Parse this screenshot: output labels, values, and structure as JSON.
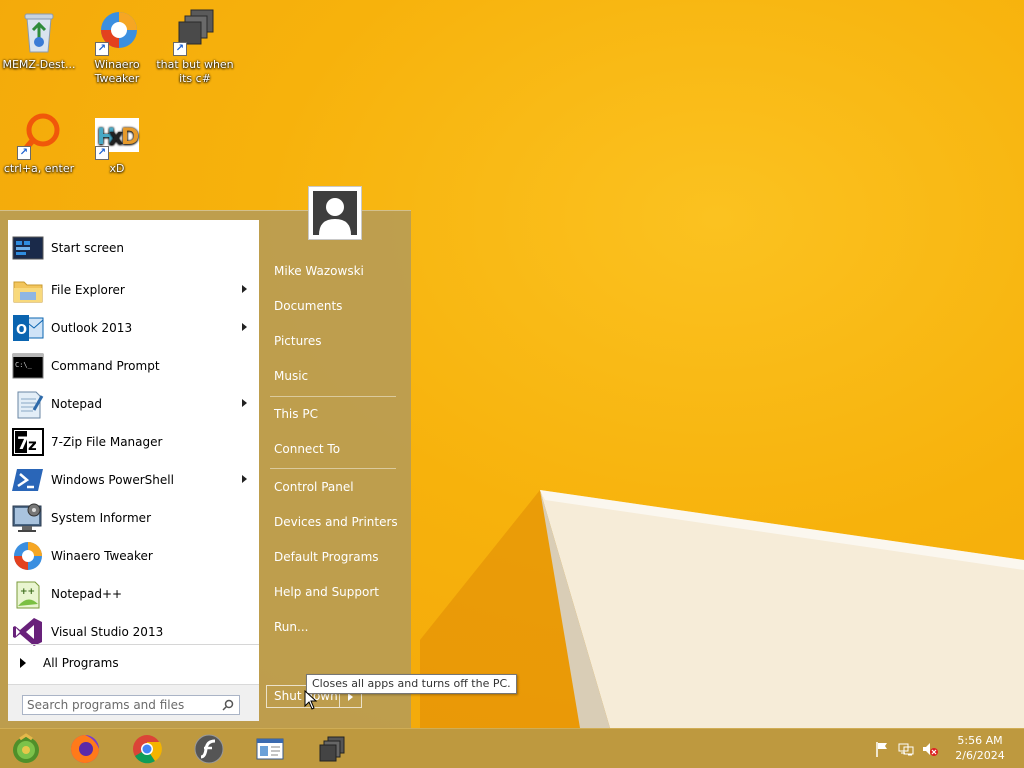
{
  "desktop": {
    "icons": [
      {
        "label": "MEMZ-Dest...",
        "icon": "recycle-bin-icon"
      },
      {
        "label": "Winaero Tweaker",
        "icon": "winaero-tweaker-icon"
      },
      {
        "label": "that but when its c#",
        "icon": "stacked-windows-icon"
      },
      {
        "label": "ctrl+a, enter",
        "icon": "magnifier-app-icon"
      },
      {
        "label": "xD",
        "icon": "hxd-icon"
      }
    ]
  },
  "start_menu": {
    "programs": [
      {
        "label": "Start screen",
        "icon": "start-screen-icon",
        "submenu": false
      },
      {
        "label": "File Explorer",
        "icon": "folder-icon",
        "submenu": true
      },
      {
        "label": "Outlook 2013",
        "icon": "outlook-icon",
        "submenu": true
      },
      {
        "label": "Command Prompt",
        "icon": "cmd-icon",
        "submenu": false
      },
      {
        "label": "Notepad",
        "icon": "notepad-icon",
        "submenu": true
      },
      {
        "label": "7-Zip File Manager",
        "icon": "7zip-icon",
        "submenu": false
      },
      {
        "label": "Windows PowerShell",
        "icon": "powershell-icon",
        "submenu": true
      },
      {
        "label": "System Informer",
        "icon": "system-informer-icon",
        "submenu": false
      },
      {
        "label": "Winaero Tweaker",
        "icon": "winaero-tweaker-icon",
        "submenu": false
      },
      {
        "label": "Notepad++",
        "icon": "notepadpp-icon",
        "submenu": false
      },
      {
        "label": "Visual Studio 2013",
        "icon": "visual-studio-icon",
        "submenu": false
      }
    ],
    "all_programs": "All Programs",
    "search_placeholder": "Search programs and files",
    "right": {
      "user": "Mike Wazowski",
      "documents": "Documents",
      "pictures": "Pictures",
      "music": "Music",
      "this_pc": "This PC",
      "connect_to": "Connect To",
      "control_panel": "Control Panel",
      "devices_printers": "Devices and Printers",
      "default_programs": "Default Programs",
      "help_support": "Help and Support",
      "run": "Run..."
    },
    "shutdown_label": "Shut down",
    "shutdown_tooltip": "Closes all apps and turns off the PC."
  },
  "taskbar": {
    "apps": [
      "start-orb-icon",
      "firefox-icon",
      "chrome-icon",
      "flash-icon",
      "window-app-icon",
      "stacked-windows-icon"
    ],
    "tray": [
      "flag-icon",
      "network-icon",
      "speaker-muted-icon"
    ],
    "time": "5:56 AM",
    "date": "2/6/2024"
  },
  "colors": {
    "wallpaper": "#F7B20C",
    "start_menu_bg": "#B89C54",
    "taskbar_bg": "#BA9842"
  }
}
